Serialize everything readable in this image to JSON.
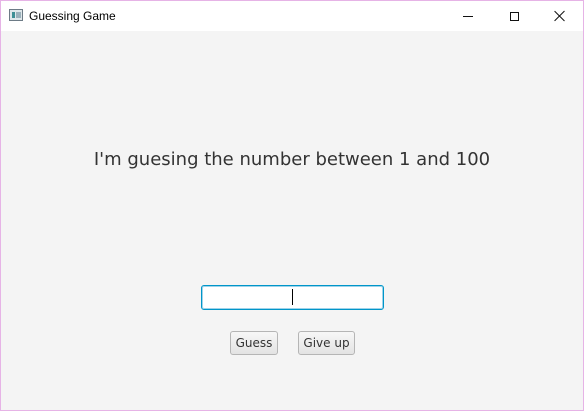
{
  "window": {
    "title": "Guessing Game",
    "app_icon": "window-app-icon",
    "controls": {
      "minimize_icon": "minimize-icon",
      "maximize_icon": "maximize-icon",
      "close_icon": "close-icon"
    }
  },
  "main": {
    "prompt": "I'm guesing the number between 1 and 100",
    "input": {
      "value": "",
      "placeholder": ""
    },
    "buttons": {
      "guess": "Guess",
      "give_up": "Give up"
    }
  },
  "colors": {
    "background": "#f4f4f4",
    "input_focus_border": "#0096c9",
    "window_border": "#e6b3e6"
  }
}
